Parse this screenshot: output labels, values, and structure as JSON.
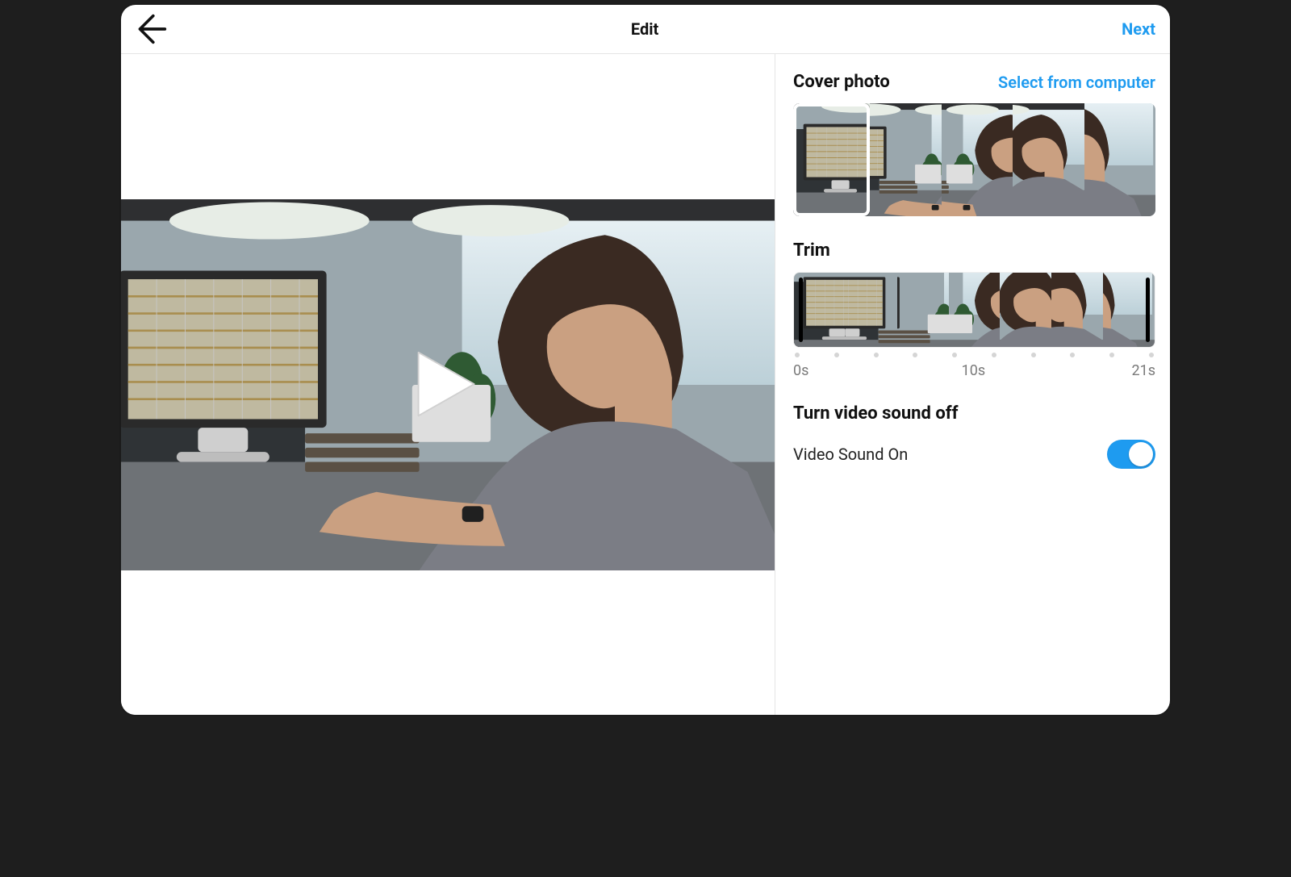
{
  "header": {
    "title": "Edit",
    "next_label": "Next"
  },
  "cover": {
    "title": "Cover photo",
    "select_label": "Select from computer",
    "thumbnail_count": 5,
    "selected_index": 0
  },
  "trim": {
    "title": "Trim",
    "frame_count": 7,
    "ticks": 10,
    "start_label": "0s",
    "mid_label": "10s",
    "end_label": "21s",
    "duration_seconds": 21
  },
  "sound": {
    "section_title": "Turn video sound off",
    "label": "Video Sound On",
    "on": true
  },
  "colors": {
    "accent": "#1e9bf0"
  }
}
